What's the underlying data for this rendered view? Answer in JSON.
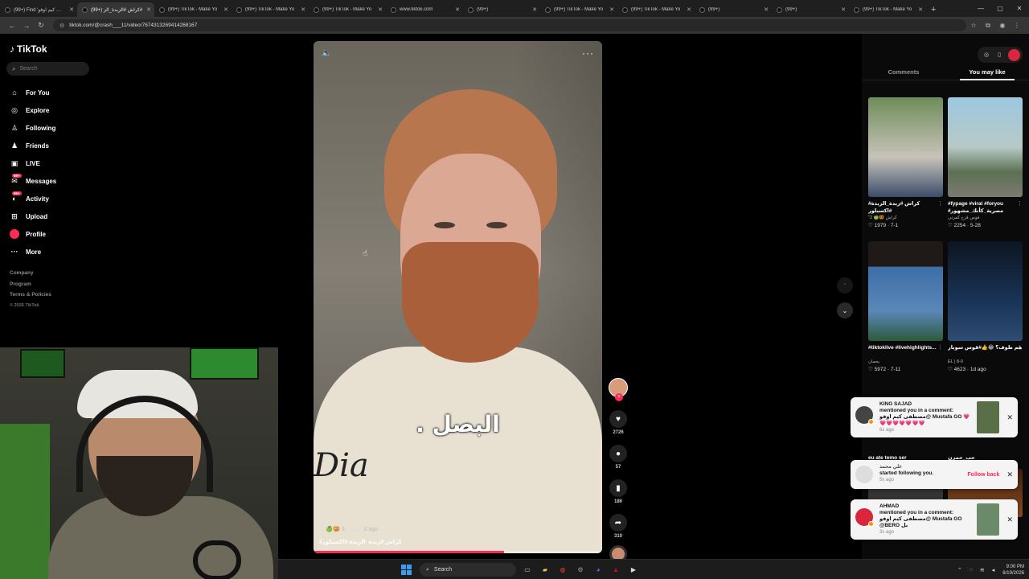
{
  "browser": {
    "tabs": [
      {
        "label": "(99+) Find 'جبس كيم اوفو'"
      },
      {
        "label": "(99+) كراش #الزبدة_الز#"
      },
      {
        "label": "(99+) TikTok - Make Yo"
      },
      {
        "label": "(99+) TikTok - Make Yo"
      },
      {
        "label": "(99+) TikTok - Make Yo"
      },
      {
        "label": "www.tiktok.com"
      },
      {
        "label": "(99+)"
      },
      {
        "label": "(99+) TikTok - Make Yo"
      },
      {
        "label": "(99+) TikTok - Make Yo"
      },
      {
        "label": "(99+)"
      },
      {
        "label": "(99+)"
      },
      {
        "label": "(99+) TikTok - Make Yo"
      }
    ],
    "url": "tiktok.com/@crash___11/video/7674313269414268167"
  },
  "sidebar": {
    "brand": "TikTok",
    "search_placeholder": "Search",
    "items": [
      {
        "label": "For You",
        "icon": "home-icon"
      },
      {
        "label": "Explore",
        "icon": "compass-icon"
      },
      {
        "label": "Following",
        "icon": "following-icon"
      },
      {
        "label": "Friends",
        "icon": "friends-icon"
      },
      {
        "label": "LIVE",
        "icon": "live-icon"
      },
      {
        "label": "Messages",
        "icon": "messages-icon",
        "badge": "99+"
      },
      {
        "label": "Activity",
        "icon": "activity-icon",
        "badge": "99+"
      },
      {
        "label": "Upload",
        "icon": "upload-icon"
      },
      {
        "label": "Profile",
        "icon": "profile-avatar"
      },
      {
        "label": "More",
        "icon": "more-icon"
      }
    ],
    "footer": {
      "company": "Company",
      "program": "Program",
      "terms": "Terms & Policies",
      "copyright": "© 2026 TikTok"
    }
  },
  "video": {
    "caption": "البصل .",
    "shirt_print": "Dia",
    "author_line": "\"2 🍏🥨 كراش",
    "date": "3d ago",
    "hashtags": "#كراش #زبدة_الزبدة #اكسبلور",
    "progress": 0.66
  },
  "actions": {
    "likes": "2726",
    "comments": "57",
    "saves": "186",
    "shares": "310"
  },
  "right_panel": {
    "tabs": [
      {
        "label": "Comments"
      },
      {
        "label": "You may like"
      }
    ],
    "active_tab": 1,
    "cards": [
      {
        "title": "#كراش #زبدة_الزبدة #اكسبلور",
        "author": "\"2 🍏🥨 كراش",
        "likes": "1979",
        "date": "7-1"
      },
      {
        "title": "#fypage #viral #foryou #مصرية_كأنك_مشهور",
        "author": "قوس قزح كمرتي",
        "likes": "2254",
        "date": "5-28"
      },
      {
        "title": "#tiktoklive #livehighlights...",
        "author": "يحمان",
        "likes": "5972",
        "date": "7-11"
      },
      {
        "title": "هم طوف؟ 😂👍#قوس سوبار",
        "author": "EL | 8-0",
        "likes": "4623",
        "date": "1d ago"
      },
      {
        "title": "eu ate temo ser",
        "author": "",
        "likes": "",
        "date": ""
      },
      {
        "title": "حب_حمزن",
        "author": "",
        "likes": "",
        "date": ""
      }
    ]
  },
  "notifications": [
    {
      "name": "KING SAJAD",
      "text": "mentioned you in a comment: مصطفى كيم اوفو@ Mustafa GO 💗💗💗💗💗💗💗💗",
      "time": "6s ago"
    },
    {
      "name": "علي محمد",
      "text": "started following you.",
      "time": "5s ago",
      "action": "Follow back"
    },
    {
      "name": "AHMAD",
      "text": "mentioned you in a comment: مصطفى كيم اوفو@ Mustafa GO @BERO بل",
      "time": "3s ago"
    }
  ],
  "taskbar": {
    "search": "Search",
    "time": "9:00 PM",
    "date": "8/19/2026"
  },
  "colors": {
    "accent": "#fe2c55",
    "background": "#000000"
  }
}
